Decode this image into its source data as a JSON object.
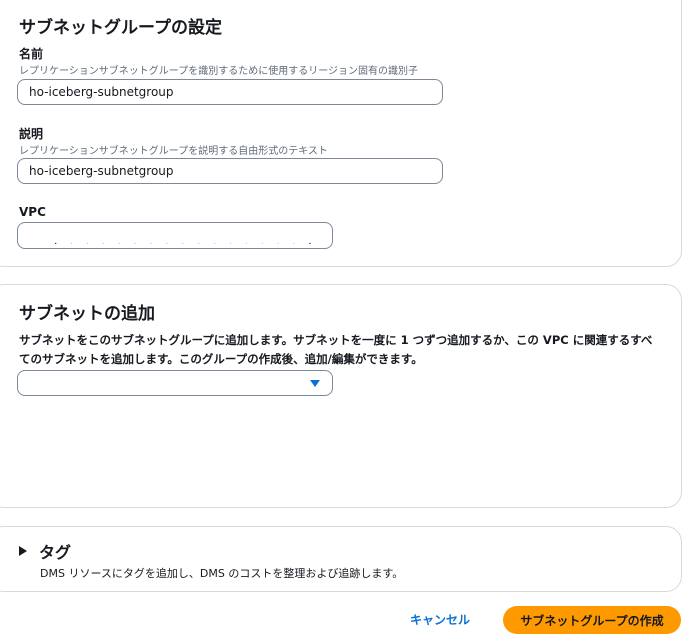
{
  "settings": {
    "title": "サブネットグループの設定",
    "name": {
      "label": "名前",
      "description": "レプリケーションサブネットグループを識別するために使用するリージョン固有の識別子",
      "value": "ho-iceberg-subnetgroup"
    },
    "description_field": {
      "label": "説明",
      "description": "レプリケーションサブネットグループを説明する自由形式のテキスト",
      "value": "ho-iceberg-subnetgroup"
    },
    "vpc": {
      "label": "VPC",
      "value": "."
    }
  },
  "subnets": {
    "title": "サブネットの追加",
    "description": "サブネットをこのサブネットグループに追加します。サブネットを一度に 1 つずつ追加するか、この VPC に関連するすべてのサブネットを追加します。このグループの作成後、追加/編集ができます。",
    "select_value": ""
  },
  "tags": {
    "title": "タグ",
    "description": "DMS リソースにタグを追加し、DMS のコストを整理および追跡します。"
  },
  "footer": {
    "cancel_label": "キャンセル",
    "create_label": "サブネットグループの作成"
  },
  "colors": {
    "primary_button": "#ff9900",
    "link": "#0972d3",
    "caret": "#0972d3"
  },
  "icons": {
    "select": "caret-down-icon",
    "tags_expand": "caret-right-icon"
  }
}
